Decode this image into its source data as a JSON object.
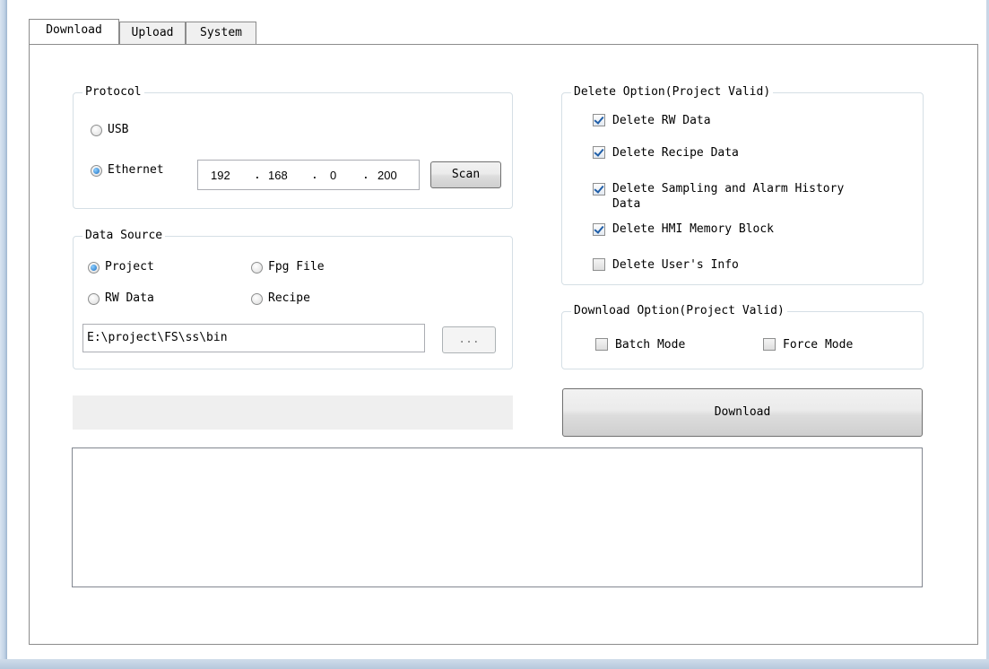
{
  "tabs": [
    {
      "label": "Download",
      "active": true
    },
    {
      "label": "Upload",
      "active": false
    },
    {
      "label": "System",
      "active": false
    }
  ],
  "protocol": {
    "legend": "Protocol",
    "usb_label": "USB",
    "usb_selected": false,
    "ethernet_label": "Ethernet",
    "ethernet_selected": true,
    "ip": {
      "o1": "192",
      "o2": "168",
      "o3": "0",
      "o4": "200",
      "sep": "."
    },
    "scan_label": "Scan"
  },
  "data_source": {
    "legend": "Data Source",
    "options": [
      {
        "label": "Project",
        "selected": true
      },
      {
        "label": "Fpg File",
        "selected": false
      },
      {
        "label": "RW Data",
        "selected": false
      },
      {
        "label": "Recipe",
        "selected": false
      }
    ],
    "path": "E:\\project\\FS\\ss\\bin",
    "browse_label": "..."
  },
  "delete_option": {
    "legend": "Delete Option(Project Valid)",
    "items": [
      {
        "label": "Delete RW Data",
        "checked": true
      },
      {
        "label": "Delete Recipe Data",
        "checked": true
      },
      {
        "label": "Delete Sampling and Alarm History",
        "label_line2": "Data",
        "checked": true
      },
      {
        "label": "Delete HMI Memory Block",
        "checked": true
      },
      {
        "label": "Delete User's Info",
        "checked": false
      }
    ]
  },
  "download_option": {
    "legend": "Download Option(Project Valid)",
    "batch_label": "Batch Mode",
    "batch_checked": false,
    "force_label": "Force Mode",
    "force_checked": false
  },
  "download_button_label": "Download",
  "progress_value": 0,
  "log_text": ""
}
